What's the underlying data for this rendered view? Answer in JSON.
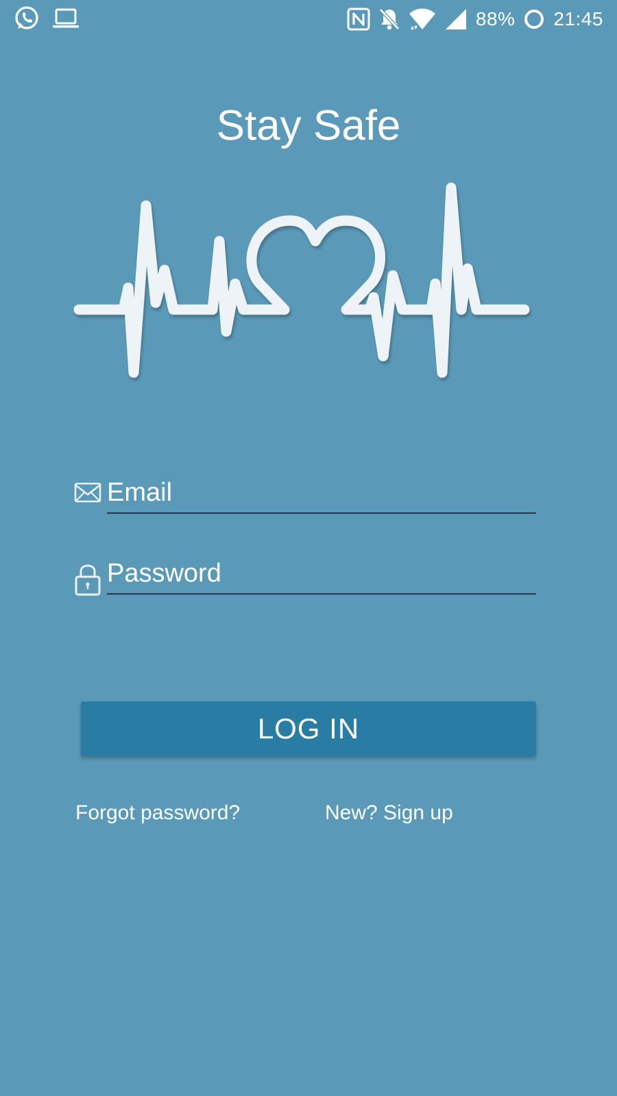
{
  "status_bar": {
    "left_icons": [
      "whatsapp-icon",
      "laptop-icon"
    ],
    "right_icons": [
      "nfc-icon",
      "bell-off-icon",
      "wifi-icon",
      "cell-signal-icon"
    ],
    "battery_percent": "88%",
    "battery_icon": "battery-ring-icon",
    "time": "21:45"
  },
  "app": {
    "title": "Stay Safe",
    "logo_icon": "heartbeat-heart-icon"
  },
  "form": {
    "email_placeholder": "Email",
    "email_icon": "envelope-icon",
    "password_placeholder": "Password",
    "password_icon": "lock-icon",
    "login_label": "LOG IN",
    "forgot_label": "Forgot password?",
    "signup_label": "New? Sign up"
  },
  "colors": {
    "background": "#5a9ab8",
    "button": "#297ca4",
    "text": "#ffffff",
    "underline": "#1f3a48"
  }
}
